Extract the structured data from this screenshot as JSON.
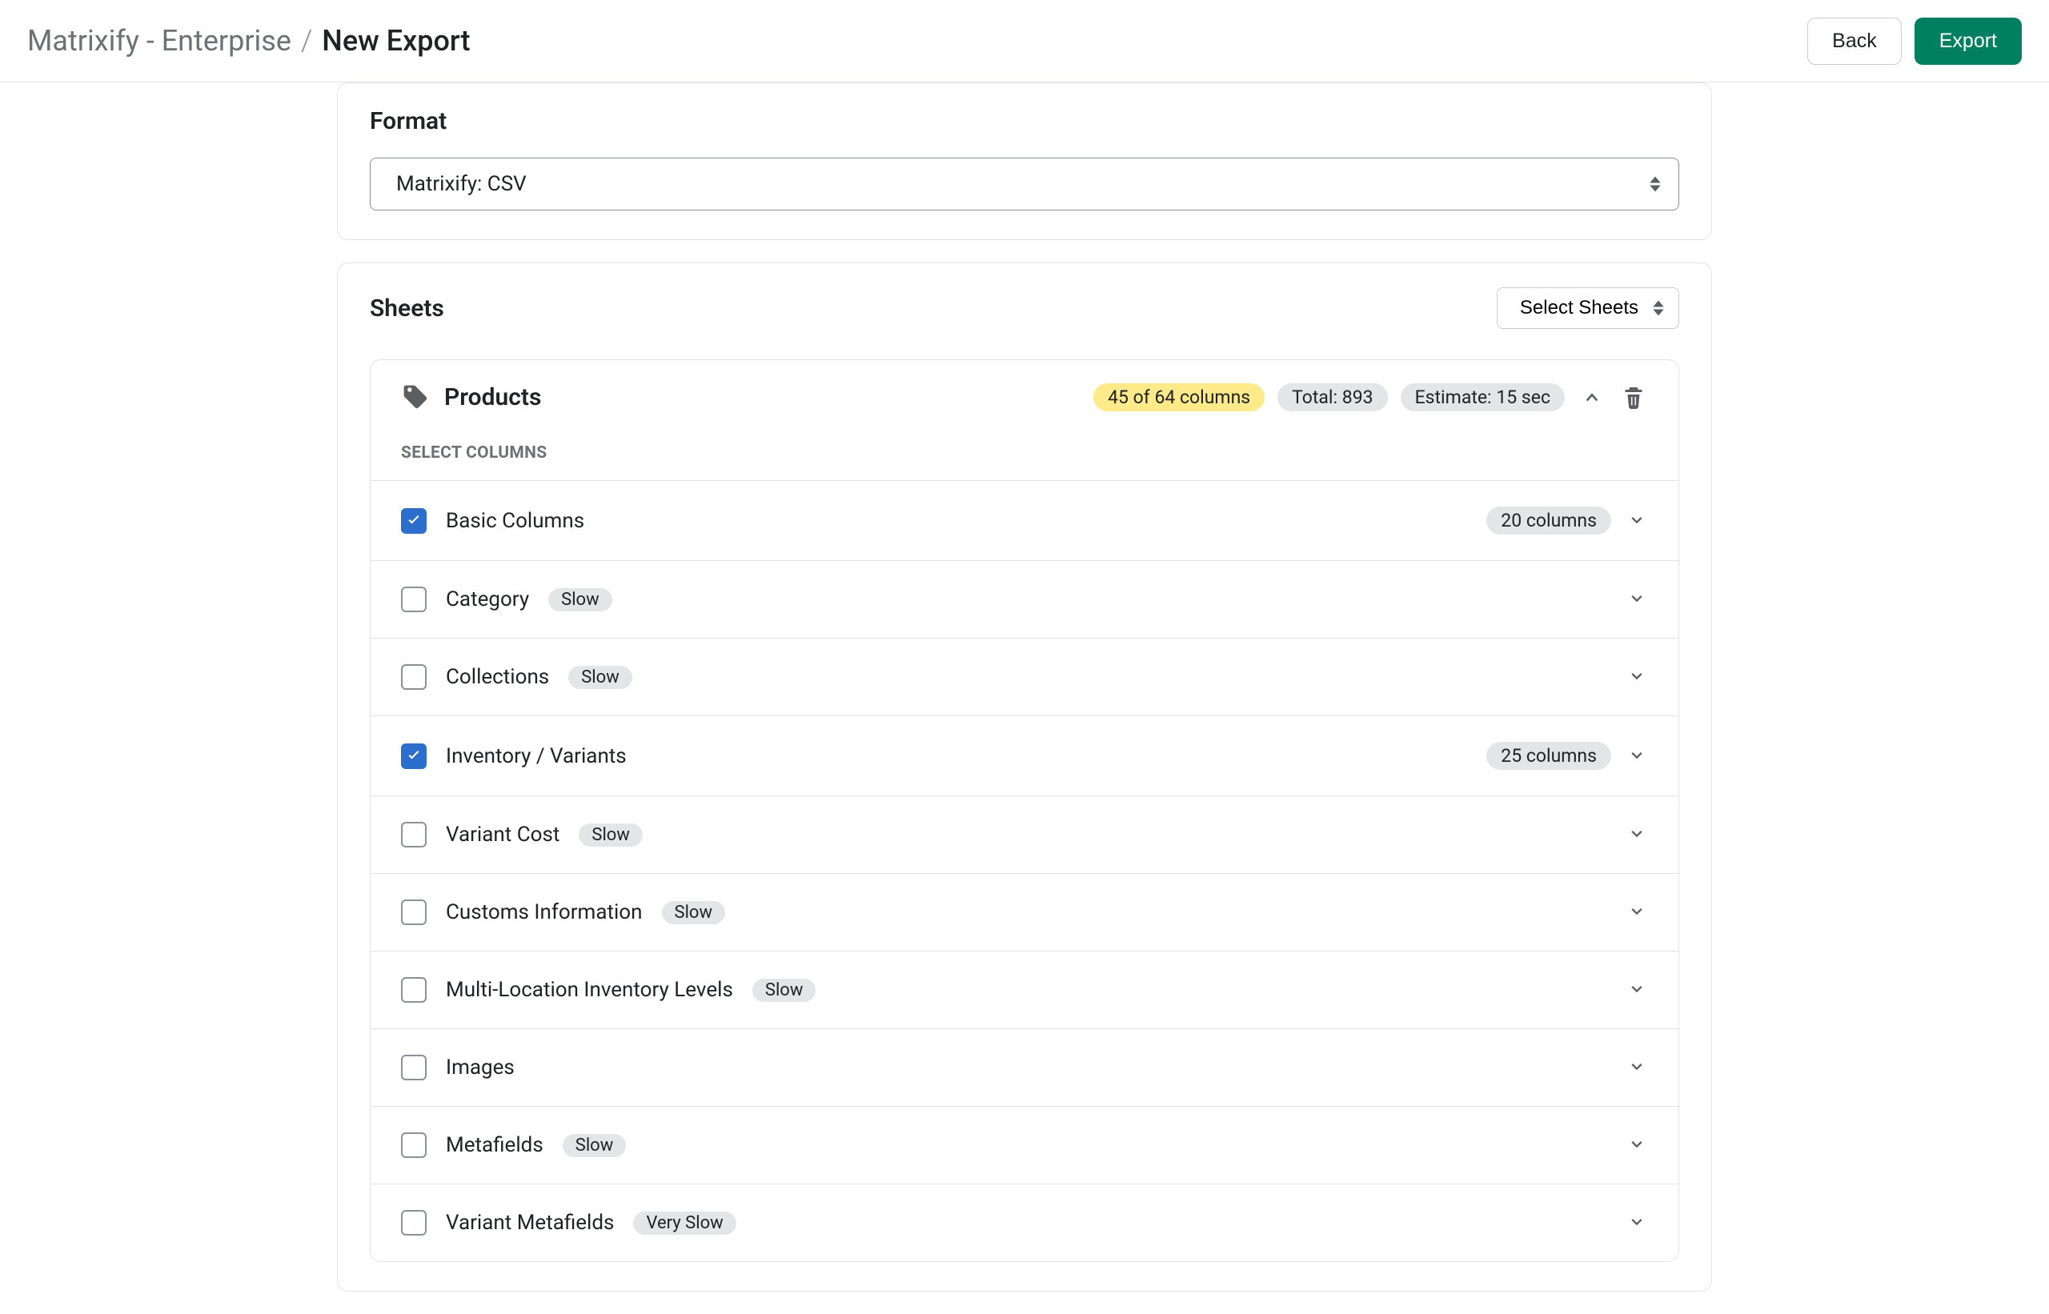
{
  "breadcrumb": {
    "app": "Matrixify - Enterprise",
    "slash": "/",
    "current": "New Export"
  },
  "top_actions": {
    "back": "Back",
    "export": "Export"
  },
  "format_section": {
    "title": "Format",
    "selected": "Matrixify: CSV"
  },
  "sheets_section": {
    "title": "Sheets",
    "select_sheets_button": "Select Sheets"
  },
  "products_sheet": {
    "name": "Products",
    "columns_badge": "45 of 64 columns",
    "total_badge": "Total: 893",
    "estimate_badge": "Estimate: 15 sec",
    "select_columns_label": "SELECT COLUMNS",
    "rows": [
      {
        "label": "Basic Columns",
        "checked": true,
        "slow": null,
        "count": "20 columns"
      },
      {
        "label": "Category",
        "checked": false,
        "slow": "Slow",
        "count": null
      },
      {
        "label": "Collections",
        "checked": false,
        "slow": "Slow",
        "count": null
      },
      {
        "label": "Inventory / Variants",
        "checked": true,
        "slow": null,
        "count": "25 columns"
      },
      {
        "label": "Variant Cost",
        "checked": false,
        "slow": "Slow",
        "count": null
      },
      {
        "label": "Customs Information",
        "checked": false,
        "slow": "Slow",
        "count": null
      },
      {
        "label": "Multi-Location Inventory Levels",
        "checked": false,
        "slow": "Slow",
        "count": null
      },
      {
        "label": "Images",
        "checked": false,
        "slow": null,
        "count": null
      },
      {
        "label": "Metafields",
        "checked": false,
        "slow": "Slow",
        "count": null
      },
      {
        "label": "Variant Metafields",
        "checked": false,
        "slow": "Very Slow",
        "count": null
      }
    ]
  }
}
